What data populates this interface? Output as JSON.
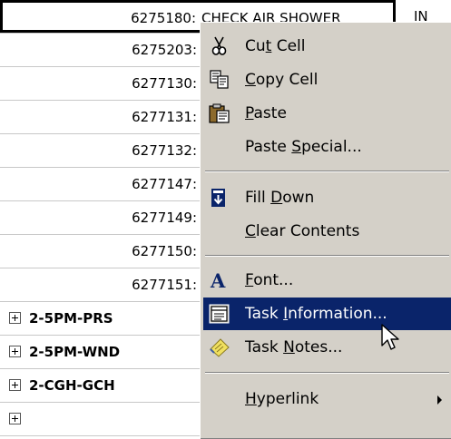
{
  "grid": {
    "rows": [
      {
        "id": "6275180:",
        "desc": "CHECK AIR SHOWER",
        "col_b": "IN"
      },
      {
        "id": "6275203:"
      },
      {
        "id": "6277130:"
      },
      {
        "id": "6277131:"
      },
      {
        "id": "6277132:"
      },
      {
        "id": "6277147:"
      },
      {
        "id": "6277149:"
      },
      {
        "id": "6277150:"
      },
      {
        "id": "6277151:"
      }
    ],
    "groups": [
      {
        "label": "2-5PM-PRS"
      },
      {
        "label": "2-5PM-WND"
      },
      {
        "label": "2-CGH-GCH"
      }
    ]
  },
  "context_menu": {
    "items": [
      {
        "pre": "Cu",
        "key": "t",
        "post": " Cell",
        "icon": "scissors-icon"
      },
      {
        "pre": "",
        "key": "C",
        "post": "opy Cell",
        "icon": "copy-icon"
      },
      {
        "pre": "",
        "key": "P",
        "post": "aste",
        "icon": "paste-icon"
      },
      {
        "pre": "Paste ",
        "key": "S",
        "post": "pecial...",
        "icon": ""
      },
      {
        "pre": "Fill ",
        "key": "D",
        "post": "own",
        "icon": "fill-down-icon"
      },
      {
        "pre": "",
        "key": "C",
        "post": "lear Contents",
        "icon": ""
      },
      {
        "pre": "",
        "key": "F",
        "post": "ont...",
        "icon": "font-icon"
      },
      {
        "pre": "Task ",
        "key": "I",
        "post": "nformation...",
        "icon": "task-information-icon",
        "highlighted": true
      },
      {
        "pre": "Task ",
        "key": "N",
        "post": "otes...",
        "icon": "task-notes-icon"
      },
      {
        "pre": "",
        "key": "H",
        "post": "yperlink",
        "icon": "",
        "submenu": true
      }
    ]
  },
  "colors": {
    "menu_bg": "#d4d0c8",
    "highlight": "#0a246a"
  }
}
